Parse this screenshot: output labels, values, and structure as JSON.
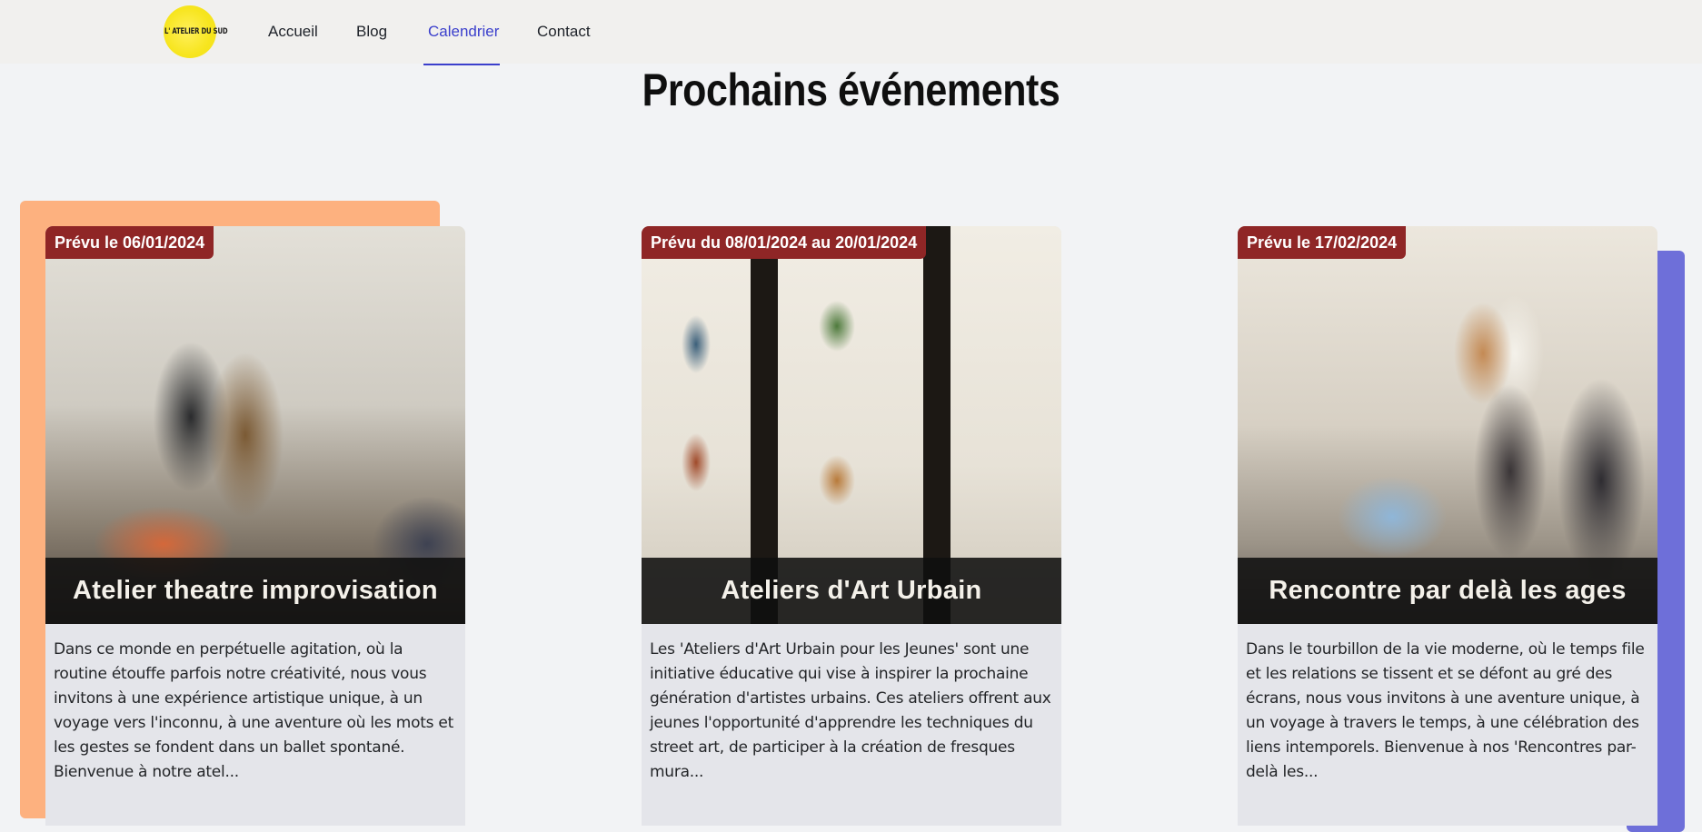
{
  "header": {
    "logo_text": "L' ATELIER DU SUD",
    "nav": [
      {
        "label": "Accueil"
      },
      {
        "label": "Blog"
      },
      {
        "label": "Calendrier",
        "active": true
      },
      {
        "label": "Contact"
      }
    ]
  },
  "page": {
    "title": "Prochains événements"
  },
  "events": [
    {
      "badge": "Prévu le 06/01/2024",
      "title": "Atelier theatre improvisation",
      "description": "Dans ce monde en perpétuelle agitation, où la routine étouffe parfois notre créativité, nous vous invitons à une expérience artistique unique, à un voyage vers l'inconnu, à une aventure où les mots et les gestes se fondent dans un ballet spontané. Bienvenue à notre atel..."
    },
    {
      "badge": "Prévu du 08/01/2024 au 20/01/2024",
      "title": "Ateliers d'Art Urbain",
      "description": "Les 'Ateliers d'Art Urbain pour les Jeunes' sont une initiative éducative qui vise à inspirer la prochaine génération d'artistes urbains. Ces ateliers offrent aux jeunes l'opportunité d'apprendre les techniques du street art, de participer à la création de fresques mura..."
    },
    {
      "badge": "Prévu le 17/02/2024",
      "title": "Rencontre par delà les ages",
      "description": "Dans le tourbillon de la vie moderne, où le temps file et les relations se tissent et se défont au gré des écrans, nous vous invitons à une aventure unique, à un voyage à travers le temps, à une célébration des liens intemporels. Bienvenue à nos 'Rencontres par-delà les..."
    }
  ],
  "colors": {
    "background": "#f2f3f5",
    "header_bg": "#f1f0ee",
    "nav_active": "#3b3fcc",
    "badge_bg": "#8f2626",
    "accent_orange": "#fdb17f",
    "accent_purple": "#6e6fd9",
    "card_bg": "#e4e5ea",
    "logo_yellow": "#f7e51e"
  }
}
